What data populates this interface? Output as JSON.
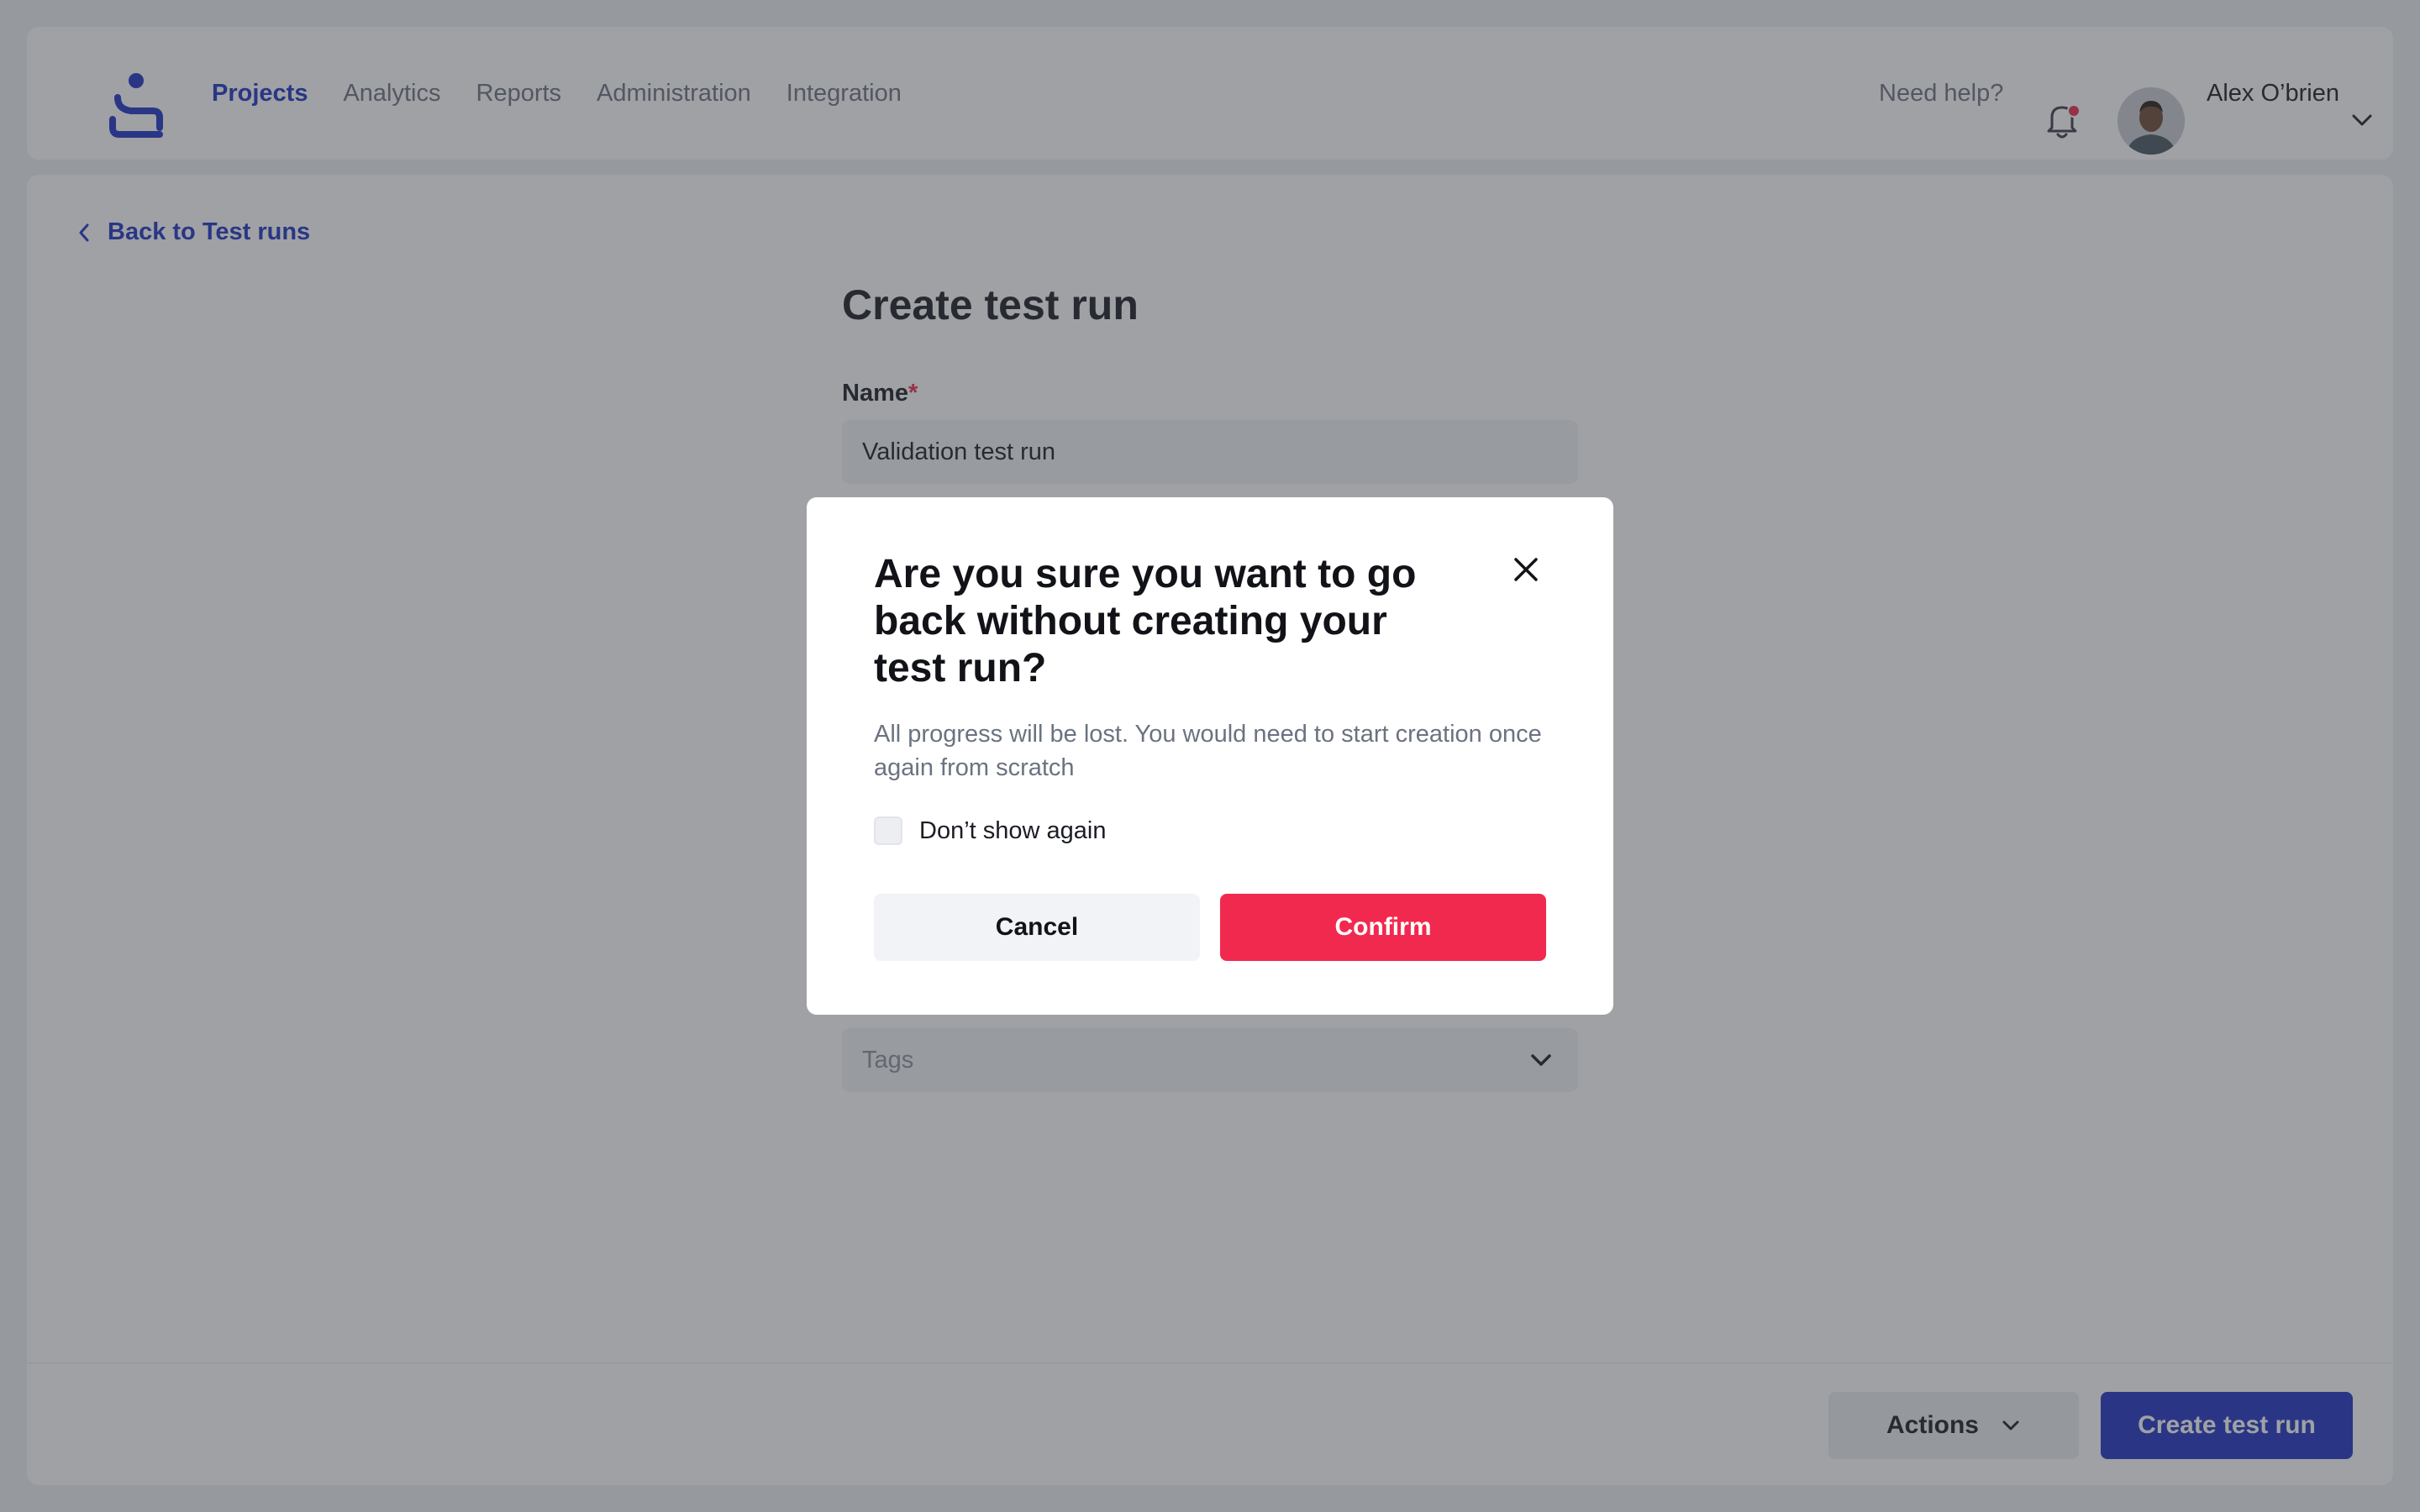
{
  "header": {
    "nav": [
      {
        "label": "Projects",
        "active": true
      },
      {
        "label": "Analytics",
        "active": false
      },
      {
        "label": "Reports",
        "active": false
      },
      {
        "label": "Administration",
        "active": false
      },
      {
        "label": "Integration",
        "active": false
      }
    ],
    "help_label": "Need help?",
    "user_name": "Alex O’brien",
    "has_notification": true
  },
  "main": {
    "back_label": "Back to Test runs",
    "title": "Create test run",
    "name_label": "Name",
    "name_required_mark": "*",
    "name_value": "Validation test run",
    "tags_placeholder": "Tags"
  },
  "footer": {
    "actions_label": "Actions",
    "create_label": "Create test run"
  },
  "modal": {
    "title": "Are you sure you want to go back without creating your test run?",
    "description": "All progress will be lost. You would need to start creation once again from scratch",
    "checkbox_label": "Don’t show again",
    "checkbox_checked": false,
    "cancel_label": "Cancel",
    "confirm_label": "Confirm"
  },
  "colors": {
    "brand": "#1f32c4",
    "danger": "#f2294e",
    "overlay": "rgba(55,58,64,0.48)"
  },
  "icons": [
    "logo-icon",
    "bell-icon",
    "chevron-down-icon",
    "chevron-left-icon",
    "close-icon"
  ]
}
